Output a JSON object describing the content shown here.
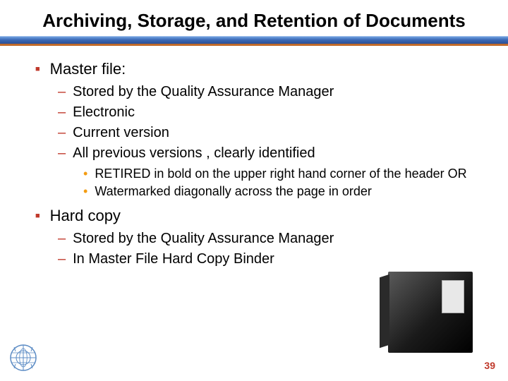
{
  "title": "Archiving, Storage, and Retention of Documents",
  "sections": [
    {
      "label": "Master file:",
      "subs": [
        {
          "label": "Stored by the Quality Assurance Manager"
        },
        {
          "label": "Electronic"
        },
        {
          "label": "Current version"
        },
        {
          "label": "All previous versions , clearly identified",
          "subsubs": [
            "RETIRED in bold on the upper right hand corner of the header OR",
            "Watermarked diagonally across the page in order"
          ]
        }
      ]
    },
    {
      "label": "Hard copy",
      "subs": [
        {
          "label": "Stored by the Quality Assurance Manager"
        },
        {
          "label": "In Master File Hard Copy Binder"
        }
      ]
    }
  ],
  "page_number": "39",
  "colors": {
    "accent_red": "#c0392b",
    "accent_orange": "#f39c12",
    "bar_blue": "#3b69b5"
  }
}
